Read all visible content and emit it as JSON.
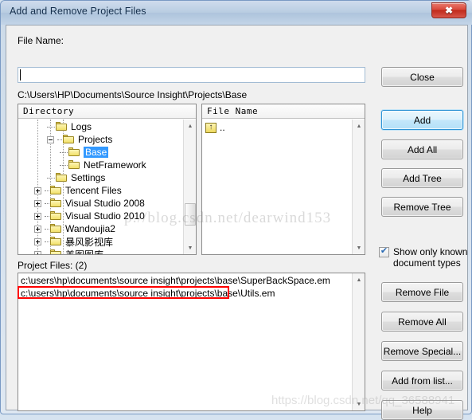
{
  "window": {
    "title": "Add and Remove Project Files",
    "close_glyph": "✖"
  },
  "form": {
    "filename_label": "File Name:",
    "filename_value": "",
    "filename_placeholder": "",
    "current_path": "C:\\Users\\HP\\Documents\\Source Insight\\Projects\\Base"
  },
  "directory_panel": {
    "header": "Directory",
    "nodes": [
      {
        "label": "Logs",
        "indent": 3,
        "expander": "none",
        "selected": false
      },
      {
        "label": "Projects",
        "indent": 3,
        "expander": "minus",
        "selected": false
      },
      {
        "label": "Base",
        "indent": 4,
        "expander": "none",
        "selected": true
      },
      {
        "label": "NetFramework",
        "indent": 4,
        "expander": "none",
        "selected": false
      },
      {
        "label": "Settings",
        "indent": 3,
        "expander": "none",
        "selected": false
      },
      {
        "label": "Tencent Files",
        "indent": 2,
        "expander": "plus",
        "selected": false
      },
      {
        "label": "Visual Studio 2008",
        "indent": 2,
        "expander": "plus",
        "selected": false
      },
      {
        "label": "Visual Studio 2010",
        "indent": 2,
        "expander": "plus",
        "selected": false
      },
      {
        "label": "Wandoujia2",
        "indent": 2,
        "expander": "plus",
        "selected": false
      },
      {
        "label": "暴风影视库",
        "indent": 2,
        "expander": "plus",
        "selected": false
      },
      {
        "label": "美图图库",
        "indent": 2,
        "expander": "plus",
        "selected": false
      }
    ]
  },
  "filename_panel": {
    "header": "File Name",
    "items": [
      {
        "label": "..",
        "icon": "folder-up-icon"
      }
    ]
  },
  "project_files": {
    "label": "Project Files: (2)",
    "rows": [
      "c:\\users\\hp\\documents\\source insight\\projects\\base\\SuperBackSpace.em",
      "c:\\users\\hp\\documents\\source insight\\projects\\base\\Utils.em"
    ]
  },
  "buttons": {
    "close": "Close",
    "add": "Add",
    "add_all": "Add All",
    "add_tree": "Add Tree",
    "remove_tree": "Remove Tree",
    "remove_file": "Remove File",
    "remove_all": "Remove All",
    "remove_special": "Remove Special...",
    "add_from_list": "Add from list...",
    "help": "Help"
  },
  "options": {
    "show_known_label": "Show only known document types",
    "show_known_checked": true
  },
  "watermarks": {
    "top": "p://blog.csdn.net/dearwind153",
    "bottom": "https://blog.csdn.net/qq_36588941"
  },
  "annotation": {
    "color": "#ff0000"
  }
}
